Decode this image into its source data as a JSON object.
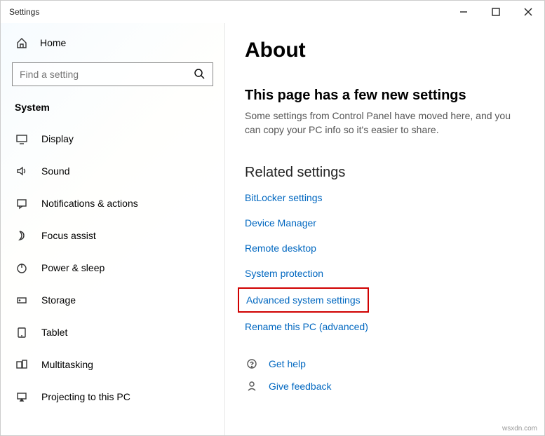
{
  "window": {
    "title": "Settings"
  },
  "sidebar": {
    "home_label": "Home",
    "search_placeholder": "Find a setting",
    "section_label": "System",
    "items": [
      {
        "label": "Display"
      },
      {
        "label": "Sound"
      },
      {
        "label": "Notifications & actions"
      },
      {
        "label": "Focus assist"
      },
      {
        "label": "Power & sleep"
      },
      {
        "label": "Storage"
      },
      {
        "label": "Tablet"
      },
      {
        "label": "Multitasking"
      },
      {
        "label": "Projecting to this PC"
      }
    ]
  },
  "main": {
    "title": "About",
    "sub_heading": "This page has a few new settings",
    "sub_body": "Some settings from Control Panel have moved here, and you can copy your PC info so it's easier to share.",
    "related_heading": "Related settings",
    "links": [
      "BitLocker settings",
      "Device Manager",
      "Remote desktop",
      "System protection",
      "Advanced system settings",
      "Rename this PC (advanced)"
    ],
    "help_link": "Get help",
    "feedback_link": "Give feedback"
  },
  "watermark": "wsxdn.com"
}
